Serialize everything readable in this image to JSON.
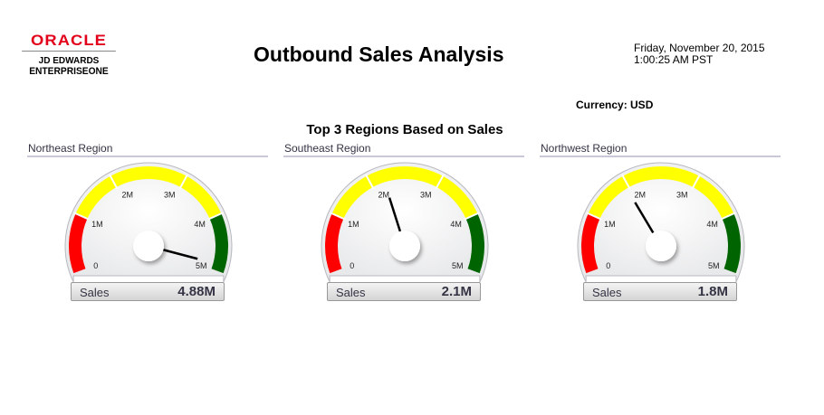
{
  "header": {
    "logo_oracle": "ORACLE",
    "logo_line1": "JD EDWARDS",
    "logo_line2": "ENTERPRISEONE",
    "title": "Outbound Sales Analysis",
    "date": "Friday, November 20, 2015",
    "time": "1:00:25 AM PST",
    "currency": "Currency: USD"
  },
  "subtitle": "Top 3 Regions Based on Sales",
  "colors": {
    "red": "#ff0000",
    "yellow": "#ffff00",
    "green": "#006400"
  },
  "gauges": [
    {
      "region": "Northeast Region",
      "label": "Sales",
      "display": "4.88M",
      "value": 4.88
    },
    {
      "region": "Southeast Region",
      "label": "Sales",
      "display": "2.1M",
      "value": 2.1
    },
    {
      "region": "Northwest Region",
      "label": "Sales",
      "display": "1.8M",
      "value": 1.8
    }
  ],
  "gauge_scale": {
    "min": 0,
    "max": 5,
    "ticks": [
      "0",
      "1M",
      "2M",
      "3M",
      "4M",
      "5M"
    ],
    "bands": [
      {
        "from": 0,
        "to": 1,
        "color": "red"
      },
      {
        "from": 1,
        "to": 4,
        "color": "yellow"
      },
      {
        "from": 4,
        "to": 5,
        "color": "green"
      }
    ]
  }
}
